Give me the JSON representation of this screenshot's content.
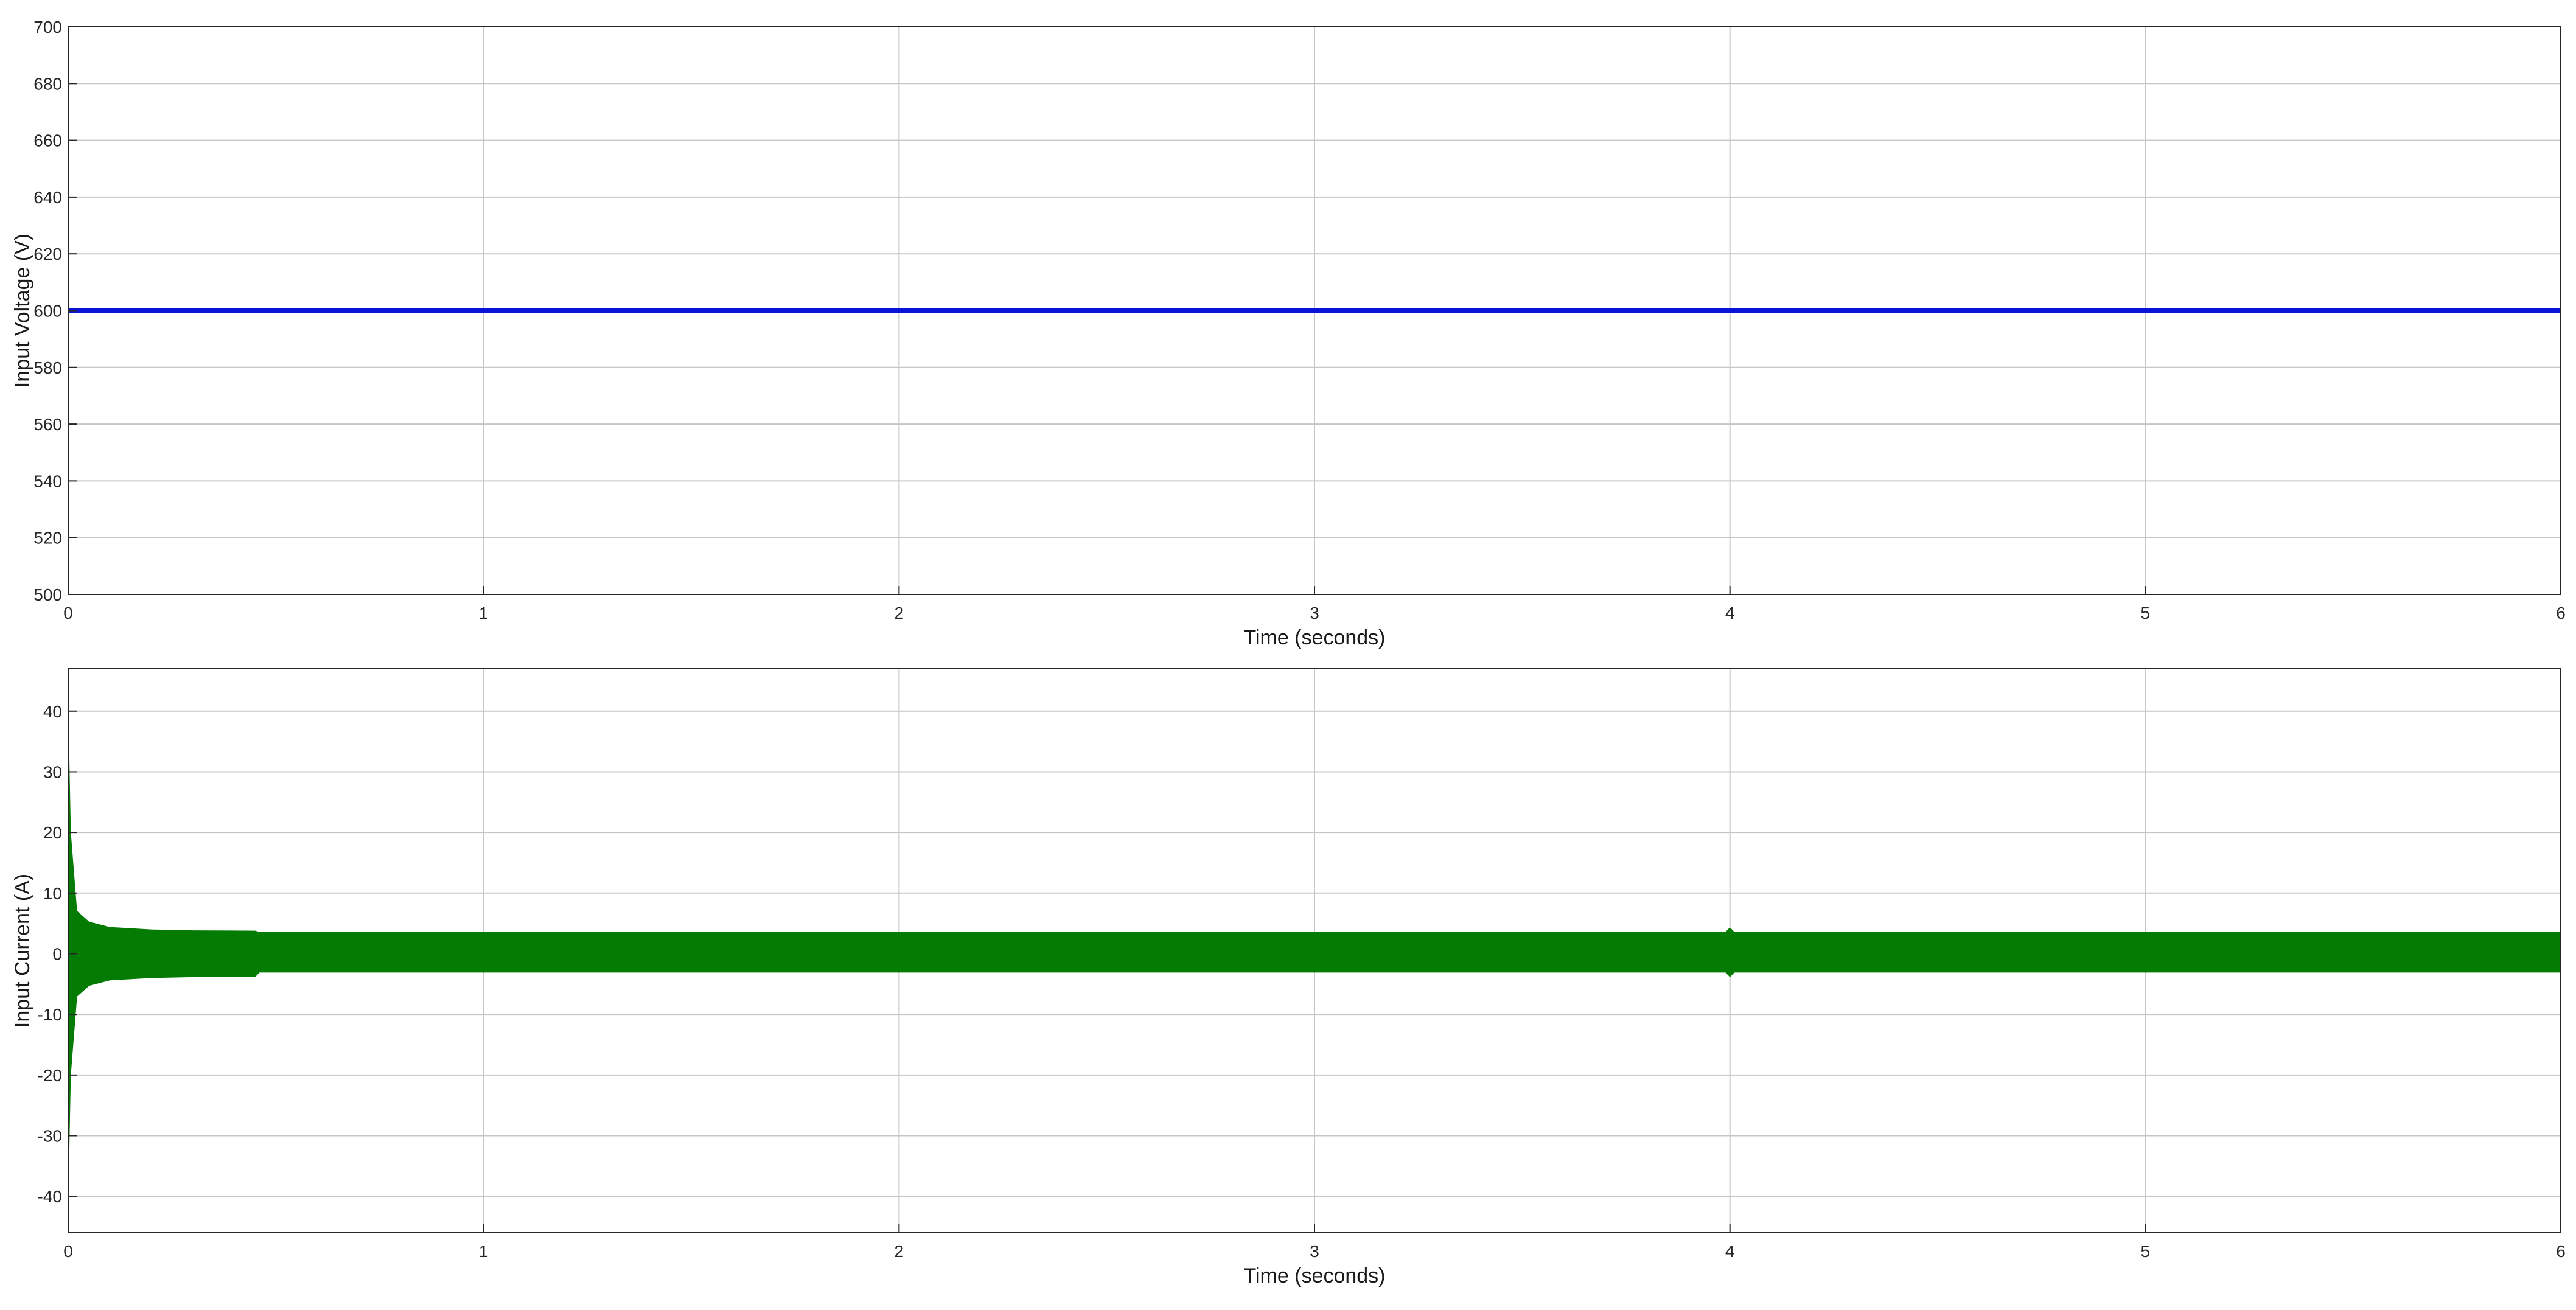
{
  "chart_data": [
    {
      "type": "line",
      "title": "",
      "xlabel": "Time (seconds)",
      "ylabel": "Input Voltage (V)",
      "xlim": [
        0,
        6
      ],
      "ylim": [
        500,
        700
      ],
      "xticks": [
        0,
        1,
        2,
        3,
        4,
        5,
        6
      ],
      "yticks": [
        500,
        520,
        540,
        560,
        580,
        600,
        620,
        640,
        660,
        680,
        700
      ],
      "grid": true,
      "series": [
        {
          "color": "#0a14d8",
          "x": [
            0,
            6
          ],
          "y": [
            600,
            600
          ]
        }
      ]
    },
    {
      "type": "line",
      "title": "",
      "xlabel": "Time (seconds)",
      "ylabel": "Input Current (A)",
      "xlim": [
        0,
        6
      ],
      "ylim": [
        -46,
        47
      ],
      "xticks": [
        0,
        1,
        2,
        3,
        4,
        5,
        6
      ],
      "yticks": [
        -40,
        -30,
        -20,
        -10,
        0,
        10,
        20,
        30,
        40
      ],
      "grid": true,
      "series": [
        {
          "color": "#047c04",
          "style": "oscillating-band",
          "x": [
            0,
            0.005,
            0.02,
            0.05,
            0.1,
            0.2,
            0.3,
            0.45,
            0.46,
            1,
            2,
            3,
            3.99,
            4.0,
            4.01,
            5,
            6
          ],
          "upper": [
            37,
            20,
            7,
            5.2,
            4.3,
            3.9,
            3.75,
            3.7,
            3.5,
            3.5,
            3.5,
            3.5,
            3.5,
            4.2,
            3.5,
            3.5,
            3.5
          ],
          "lower": [
            -37,
            -20,
            -7,
            -5.2,
            -4.3,
            -3.9,
            -3.75,
            -3.7,
            -3.0,
            -3.0,
            -3.0,
            -3.0,
            -3.0,
            -3.7,
            -3.0,
            -3.0,
            -3.0
          ]
        }
      ]
    }
  ]
}
